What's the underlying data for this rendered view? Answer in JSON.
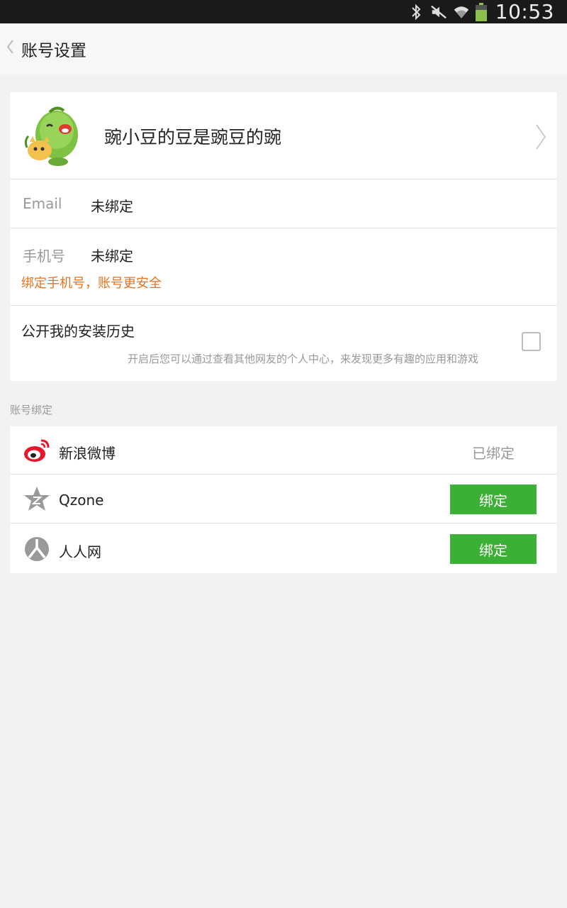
{
  "status_bar": {
    "time": "10:53",
    "icons": [
      "bluetooth-icon",
      "mute-icon",
      "wifi-icon",
      "battery-icon"
    ]
  },
  "header": {
    "back_icon": "chevron-left-icon",
    "title": "账号设置"
  },
  "profile": {
    "nickname": "豌小豆的豆是豌豆的豌",
    "arrow_icon": "chevron-right-icon"
  },
  "email": {
    "label": "Email",
    "value": "未绑定"
  },
  "phone": {
    "label": "手机号",
    "value": "未绑定",
    "tip": "绑定手机号，账号更安全"
  },
  "install_history": {
    "title": "公开我的安装历史",
    "description": "开启后您可以通过查看其他网友的个人中心，来发现更多有趣的应用和游戏",
    "checked": false
  },
  "account_binding": {
    "section_label": "账号绑定",
    "items": [
      {
        "name": "新浪微博",
        "icon": "weibo-icon",
        "status": "已绑定"
      },
      {
        "name": "Qzone",
        "icon": "qzone-icon",
        "button": "绑定"
      },
      {
        "name": "人人网",
        "icon": "renren-icon",
        "button": "绑定"
      }
    ]
  },
  "colors": {
    "accent_green": "#3cb034",
    "tip_orange": "#e8731e",
    "background": "#f2f2f2"
  }
}
